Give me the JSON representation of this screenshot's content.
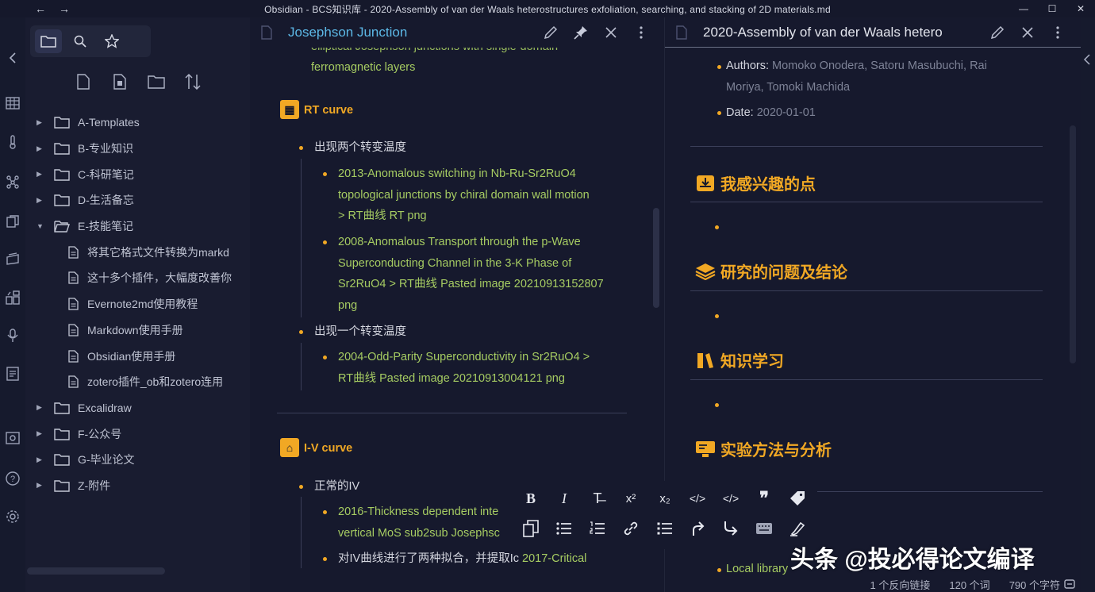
{
  "window": {
    "title": "Obsidian - BCS知识库 - 2020-Assembly of van der Waals heterostructures exfoliation, searching, and stacking of 2D materials.md",
    "back": "←",
    "forward": "→",
    "minimize": "—",
    "maximize": "☐",
    "close": "✕"
  },
  "explorer": {
    "tabs": [
      "folder-icon",
      "search-icon",
      "star-icon"
    ],
    "actions": [
      "new-note-icon",
      "new-canvas-icon",
      "new-folder-icon",
      "sort-icon"
    ],
    "items": [
      {
        "label": "A-Templates",
        "type": "folder",
        "expanded": false
      },
      {
        "label": "B-专业知识",
        "type": "folder",
        "expanded": false
      },
      {
        "label": "C-科研笔记",
        "type": "folder",
        "expanded": false
      },
      {
        "label": "D-生活备忘",
        "type": "folder",
        "expanded": false
      },
      {
        "label": "E-技能笔记",
        "type": "folder",
        "expanded": true
      },
      {
        "label": "将其它格式文件转换为markd",
        "type": "file"
      },
      {
        "label": "这十多个插件，大幅度改善你",
        "type": "file"
      },
      {
        "label": "Evernote2md使用教程",
        "type": "file"
      },
      {
        "label": "Markdown使用手册",
        "type": "file"
      },
      {
        "label": "Obsidian使用手册",
        "type": "file"
      },
      {
        "label": "zotero插件_ob和zotero连用",
        "type": "file"
      },
      {
        "label": "Excalidraw",
        "type": "folder",
        "expanded": false
      },
      {
        "label": "F-公众号",
        "type": "folder",
        "expanded": false
      },
      {
        "label": "G-毕业论文",
        "type": "folder",
        "expanded": false
      },
      {
        "label": "Z-附件",
        "type": "folder",
        "expanded": false
      }
    ]
  },
  "pane1": {
    "title": "Josephson Junction",
    "partial_line": "elliptical Josephson junctions with single-domain",
    "partial_line2": "ferromagnetic layers",
    "rt_heading": "RT curve",
    "rt_item1": "出现两个转变温度",
    "rt_link1_l1": "2013-Anomalous switching in Nb-Ru-Sr2RuO4",
    "rt_link1_l2": "topological junctions by chiral domain wall motion",
    "rt_link1_l3": "> RT曲线 RT png",
    "rt_link2_l1": "2008-Anomalous Transport through the p-Wave",
    "rt_link2_l2": "Superconducting Channel in the 3-K Phase of",
    "rt_link2_l3": "Sr2RuO4 > RT曲线 Pasted image 20210913152807",
    "rt_link2_l4": "png",
    "rt_item2": "出现一个转变温度",
    "rt_link3_l1": "2004-Odd-Parity Superconductivity in Sr2RuO4 >",
    "rt_link3_l2": "RT曲线 Pasted image 20210913004121 png",
    "iv_heading": "I-V curve",
    "iv_item1": "正常的IV",
    "iv_link1_l1": "2016-Thickness dependent inte",
    "iv_link1_l2": "vertical MoS sub2sub Josephsc",
    "iv_item2_prefix": "对IV曲线进行了两种拟合，并提取Ic",
    "iv_item2_link": "2017-Critical"
  },
  "pane2": {
    "title": "2020-Assembly of van der Waals hetero",
    "authors_label": "Authors:",
    "authors_l1": "Momoko Onodera, Satoru Masubuchi, Rai",
    "authors_l2": "Moriya, Tomoki Machida",
    "date_label": "Date:",
    "date_value": "2020-01-01",
    "h_interest": "我感兴趣的点",
    "h_problem": "研究的问题及结论",
    "h_learn": "知识学习",
    "h_method": "实验方法与分析",
    "local_library": "Local library"
  },
  "format_toolbar": {
    "row1": [
      "B",
      "I",
      "T̶",
      "x²",
      "x₂",
      "</>",
      "</>",
      "❞",
      "tag"
    ],
    "row2": [
      "copy",
      "list",
      "numbered-list",
      "link",
      "bullets",
      "indent",
      "outdent",
      "keyboard",
      "highlight"
    ]
  },
  "status": {
    "backlinks": "1 个反向链接",
    "words": "120 个词",
    "chars": "790 个字符"
  },
  "watermark": "头条 @投必得论文编译",
  "colors": {
    "accent_orange": "#f1a824",
    "link_green": "#a6cc62",
    "title_blue": "#5cb8e6",
    "background": "#16192d"
  }
}
